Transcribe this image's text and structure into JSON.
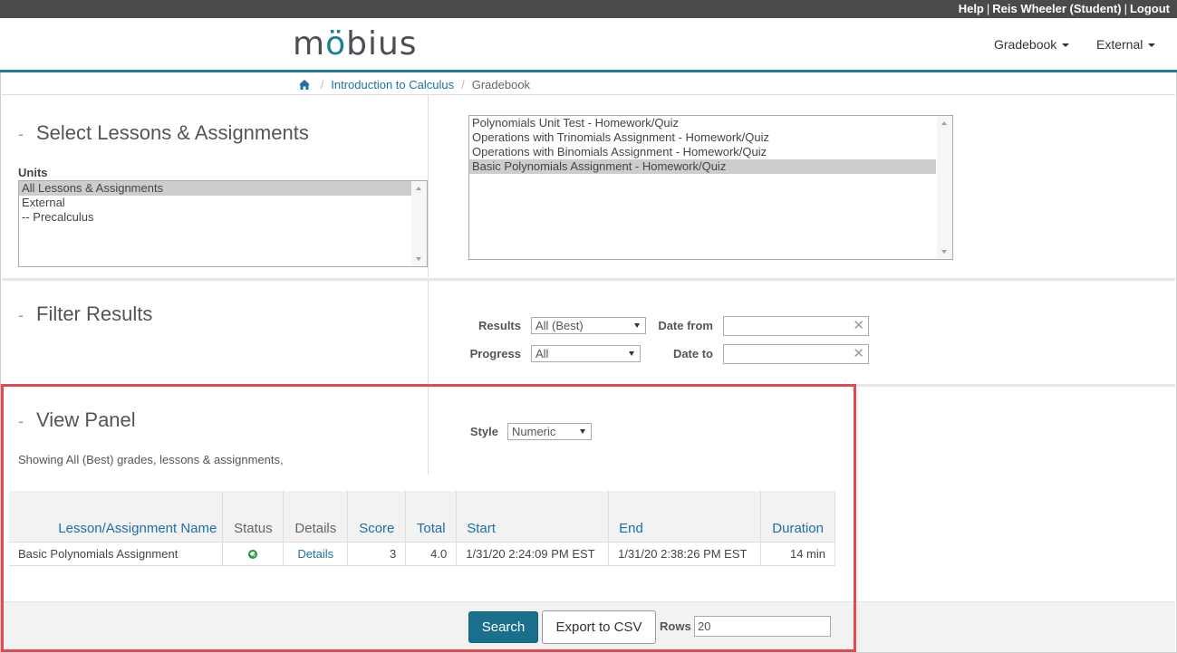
{
  "topbar": {
    "help": "Help",
    "user": "Reis Wheeler (Student)",
    "logout": "Logout",
    "separator": "|"
  },
  "header": {
    "logo_text_1": "m",
    "logo_text_2": "ö",
    "logo_text_3": "bius",
    "nav": {
      "gradebook": "Gradebook",
      "external": "External"
    }
  },
  "breadcrumb": {
    "home_icon": "home-icon",
    "course": "Introduction to Calculus",
    "current": "Gradebook",
    "separator": "/"
  },
  "select_section": {
    "title": "Select Lessons & Assignments",
    "dash": "-",
    "units_label": "Units",
    "units": [
      {
        "label": "All Lessons & Assignments",
        "selected": true
      },
      {
        "label": "External",
        "selected": false
      },
      {
        "label": "-- Precalculus",
        "selected": false
      }
    ],
    "assignments": [
      {
        "label": "Polynomials Unit Test - Homework/Quiz",
        "selected": false
      },
      {
        "label": "Operations with Trinomials Assignment - Homework/Quiz",
        "selected": false
      },
      {
        "label": "Operations with Binomials Assignment - Homework/Quiz",
        "selected": false
      },
      {
        "label": "Basic Polynomials Assignment - Homework/Quiz",
        "selected": true
      }
    ]
  },
  "filter_section": {
    "title": "Filter Results",
    "dash": "-",
    "results_label": "Results",
    "results_value": "All (Best)",
    "progress_label": "Progress",
    "progress_value": "All",
    "date_from_label": "Date from",
    "date_to_label": "Date to",
    "clear_glyph": "✕"
  },
  "view_section": {
    "title": "View Panel",
    "dash": "-",
    "style_label": "Style",
    "style_value": "Numeric",
    "showing": "Showing All (Best) grades, lessons & assignments,"
  },
  "table": {
    "headers": {
      "name": "Lesson/Assignment Name",
      "status": "Status",
      "details": "Details",
      "score": "Score",
      "total": "Total",
      "start": "Start",
      "end": "End",
      "duration": "Duration"
    },
    "rows": [
      {
        "name": "Basic Polynomials Assignment",
        "status_icon": "check-circle-icon",
        "details": "Details",
        "score": "3",
        "total": "4.0",
        "start": "1/31/20 2:24:09 PM EST",
        "end": "1/31/20 2:38:26 PM EST",
        "duration": "14 min"
      }
    ]
  },
  "footer": {
    "search": "Search",
    "export": "Export to CSV",
    "rows_label": "Rows",
    "rows_value": "20"
  },
  "colors": {
    "accent": "#1d7f96",
    "link": "#1d6fa5",
    "primary_button": "#1a708c",
    "highlight": "#e24a4f",
    "topbar": "#4a4a4a"
  }
}
